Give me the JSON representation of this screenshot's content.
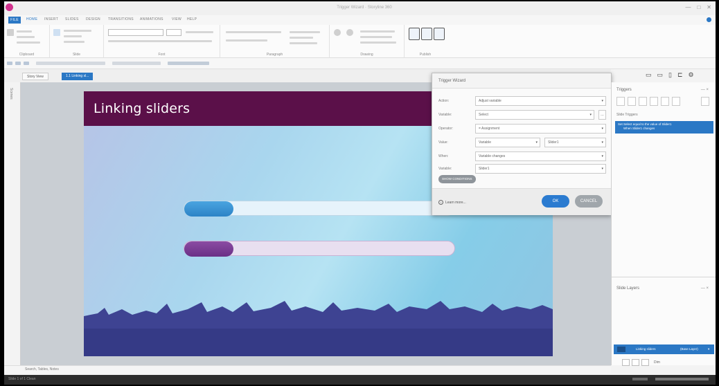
{
  "window": {
    "title": "Trigger Wizard · Storyline 360",
    "controls": [
      "—",
      "□",
      "✕"
    ]
  },
  "ribbon": {
    "tabs": [
      "FILE",
      "HOME",
      "INSERT",
      "SLIDES",
      "DESIGN",
      "TRANSITIONS",
      "ANIMATIONS",
      "VIEW",
      "HELP"
    ],
    "active_tab": "HOME",
    "groups": [
      "Clipboard",
      "Slide",
      "Font",
      "Paragraph",
      "Drawing",
      "Publish"
    ]
  },
  "doc_tabs": {
    "home": "Story View",
    "active": "1.1 Linking sl..."
  },
  "left_rail": {
    "label": "Scenes"
  },
  "slide": {
    "title": "Linking sliders",
    "slider1_value": 0.18,
    "slider2_value": 0.18,
    "colors": {
      "band": "#5b1049",
      "slider1": "#2c83c6",
      "slider2": "#6a2f86",
      "reef": "#3b3f8f"
    }
  },
  "dialog": {
    "title": "Trigger Wizard",
    "rows": [
      {
        "label": "Action:",
        "value": "Adjust variable"
      },
      {
        "label": "Variable:",
        "value": "Select"
      },
      {
        "label": "Operator:",
        "value": "= Assignment"
      },
      {
        "label": "Value:",
        "value": "Variable",
        "extra": "Slider1"
      },
      {
        "label": "When:",
        "value": "Variable changes"
      },
      {
        "label": "Variable:",
        "value": "Slider1"
      }
    ],
    "add_conditions": "SHOW CONDITIONS",
    "learn_more": "Learn more...",
    "ok": "OK",
    "cancel": "CANCEL"
  },
  "right_panel": {
    "triggers_title": "Triggers",
    "slide_triggers": "Slide Triggers",
    "trigger_item_line1": "Set Select equal to the value of Slider1",
    "trigger_item_line2": "When Slider1 changes",
    "slide_layers_title": "Slide Layers",
    "base_layer": "Linking sliders",
    "base_layer_right": "(Base Layer)",
    "dim_label": "Dim"
  },
  "search_bar": {
    "text": "Search, Tables, Notes"
  },
  "status_bar": {
    "left": "Slide 1 of 1   Clean"
  }
}
